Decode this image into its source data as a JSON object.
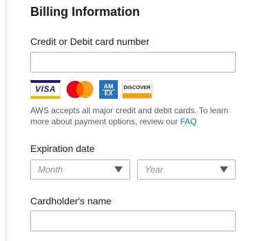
{
  "section": {
    "title": "Billing Information"
  },
  "card_number": {
    "label": "Credit or Debit card number",
    "value": ""
  },
  "card_logos": [
    {
      "name": "visa",
      "text": "VISA"
    },
    {
      "name": "mastercard",
      "text": ""
    },
    {
      "name": "amex",
      "text": "AM EX"
    },
    {
      "name": "discover",
      "text": "DISCOVER"
    }
  ],
  "helper": {
    "text": "AWS accepts all major credit and debit cards. To learn more about payment options, review our ",
    "link": "FAQ"
  },
  "expiration": {
    "label": "Expiration date",
    "month_placeholder": "Month",
    "year_placeholder": "Year"
  },
  "cardholder": {
    "label": "Cardholder's name",
    "value": ""
  },
  "colors": {
    "link": "#0073bb",
    "border": "#aab7b8",
    "text": "#16191f",
    "muted": "#545b64"
  }
}
